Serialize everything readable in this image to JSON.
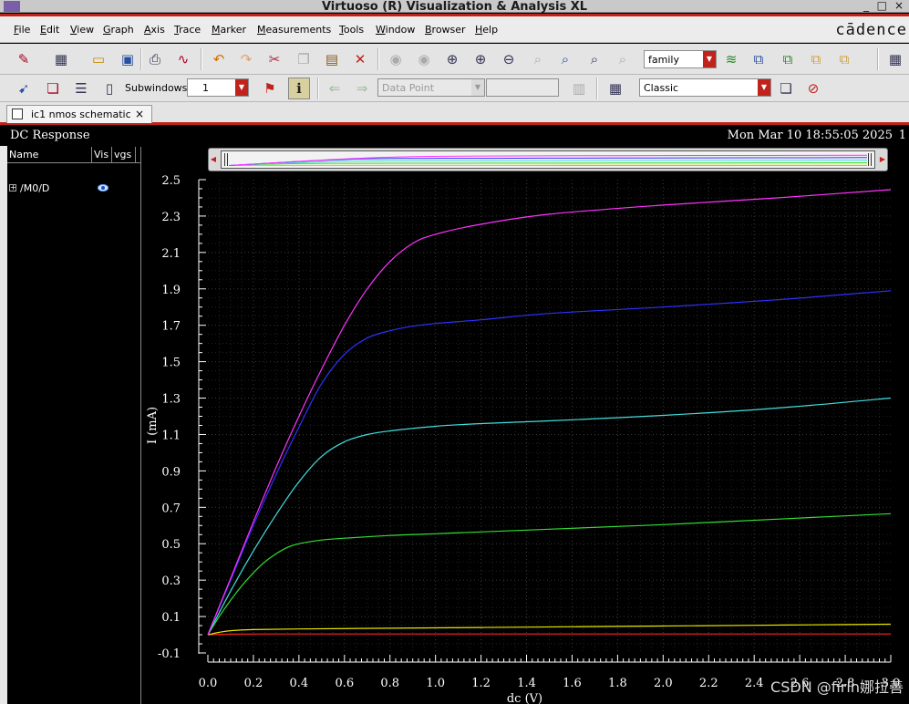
{
  "window": {
    "title": "Virtuoso (R) Visualization & Analysis XL",
    "controls": [
      "_",
      "□",
      "×"
    ]
  },
  "menu": [
    "File",
    "Edit",
    "View",
    "Graph",
    "Axis",
    "Trace",
    "Marker",
    "Measurements",
    "Tools",
    "Window",
    "Browser",
    "Help"
  ],
  "brand": "cādence",
  "toolbar1": {
    "family_combo": "family"
  },
  "toolbar2": {
    "subwindows_label": "Subwindows:",
    "subwindows_value": "1",
    "datapoint_combo": "Data Point",
    "style_combo": "Classic"
  },
  "tab": {
    "label": "ic1 nmos schematic",
    "close": "×"
  },
  "graph": {
    "title": "DC Response",
    "timestamp": "Mon Mar 10 18:55:05 2025",
    "subwindow_number": "1"
  },
  "signal_panel": {
    "col_name": "Name",
    "col_vis": "Vis",
    "col_vgs": "vgs",
    "expander": "+",
    "signal": "/M0/D"
  },
  "chart_data": {
    "type": "line",
    "xlabel": "dc (V)",
    "ylabel": "I (mA)",
    "xlim": [
      0.0,
      3.0
    ],
    "ylim": [
      -0.1,
      2.5
    ],
    "xticks": [
      "0.0",
      "0.2",
      "0.4",
      "0.6",
      "0.8",
      "1.0",
      "1.2",
      "1.4",
      "1.6",
      "1.8",
      "2.0",
      "2.2",
      "2.4",
      "2.6",
      "2.8",
      "3.0"
    ],
    "yticks": [
      "2.5",
      "2.3",
      "2.1",
      "1.9",
      "1.7",
      "1.5",
      "1.3",
      "1.1",
      "0.9",
      "0.7",
      "0.5",
      "0.3",
      "0.1",
      "-0.1"
    ],
    "grid": true,
    "series": [
      {
        "color": "#ff2020",
        "x": [
          0.0,
          0.1,
          0.3,
          0.6,
          1.0,
          1.5,
          2.0,
          2.5,
          3.0
        ],
        "y": [
          0.0,
          0.003,
          0.004,
          0.004,
          0.004,
          0.004,
          0.004,
          0.004,
          0.004
        ]
      },
      {
        "color": "#e6e600",
        "x": [
          0.0,
          0.05,
          0.1,
          0.2,
          0.4,
          0.8,
          1.2,
          1.6,
          2.0,
          2.4,
          2.8,
          3.0
        ],
        "y": [
          0.0,
          0.013,
          0.022,
          0.028,
          0.032,
          0.036,
          0.04,
          0.044,
          0.048,
          0.052,
          0.056,
          0.058
        ]
      },
      {
        "color": "#33dd33",
        "x": [
          0.0,
          0.05,
          0.1,
          0.15,
          0.2,
          0.25,
          0.3,
          0.35,
          0.4,
          0.5,
          0.6,
          0.8,
          1.0,
          1.2,
          1.5,
          2.0,
          2.5,
          3.0
        ],
        "y": [
          0.0,
          0.1,
          0.19,
          0.27,
          0.34,
          0.4,
          0.445,
          0.48,
          0.5,
          0.52,
          0.53,
          0.545,
          0.555,
          0.565,
          0.58,
          0.605,
          0.635,
          0.665
        ]
      },
      {
        "color": "#44dddd",
        "x": [
          0.0,
          0.1,
          0.2,
          0.3,
          0.4,
          0.5,
          0.6,
          0.7,
          0.8,
          1.0,
          1.2,
          1.5,
          2.0,
          2.5,
          3.0
        ],
        "y": [
          0.0,
          0.24,
          0.46,
          0.66,
          0.84,
          0.98,
          1.06,
          1.1,
          1.12,
          1.145,
          1.16,
          1.175,
          1.205,
          1.245,
          1.3
        ]
      },
      {
        "color": "#3030ff",
        "x": [
          0.0,
          0.1,
          0.2,
          0.3,
          0.4,
          0.5,
          0.6,
          0.7,
          0.8,
          0.9,
          1.0,
          1.2,
          1.5,
          2.0,
          2.5,
          3.0
        ],
        "y": [
          0.0,
          0.3,
          0.6,
          0.88,
          1.14,
          1.38,
          1.54,
          1.63,
          1.67,
          1.695,
          1.71,
          1.73,
          1.765,
          1.8,
          1.84,
          1.89
        ]
      },
      {
        "color": "#ff33ff",
        "x": [
          0.0,
          0.1,
          0.2,
          0.3,
          0.4,
          0.5,
          0.6,
          0.7,
          0.8,
          0.9,
          1.0,
          1.2,
          1.5,
          2.0,
          2.5,
          3.0
        ],
        "y": [
          0.0,
          0.31,
          0.62,
          0.92,
          1.2,
          1.46,
          1.7,
          1.9,
          2.05,
          2.15,
          2.2,
          2.255,
          2.31,
          2.36,
          2.4,
          2.445
        ]
      }
    ]
  },
  "watermark": "CSDN @firin娜拉善"
}
